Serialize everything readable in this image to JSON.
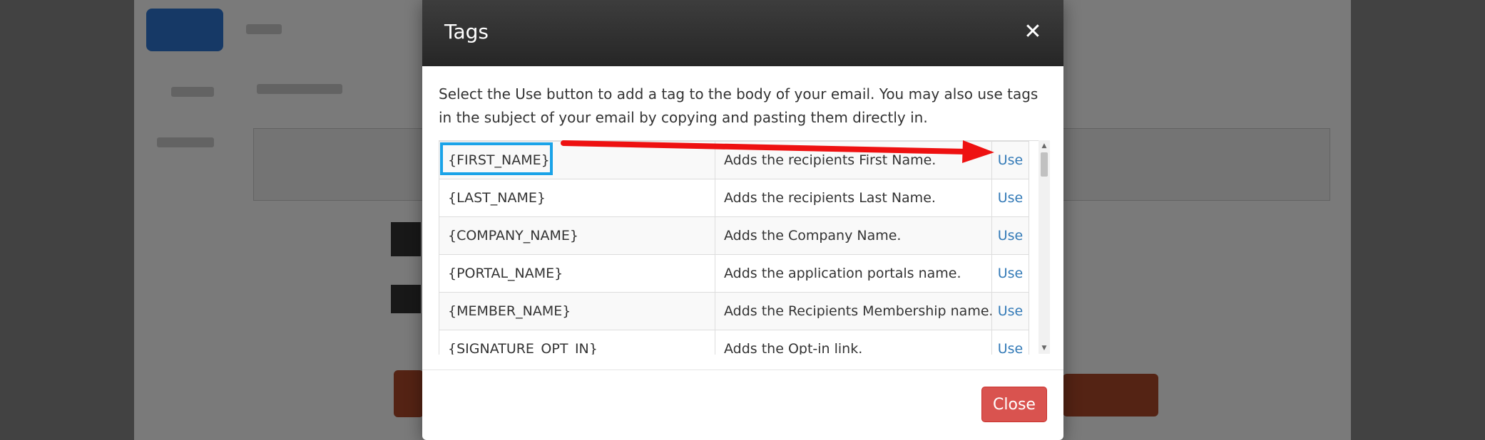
{
  "modal": {
    "title": "Tags",
    "close_icon": "close-icon",
    "description": "Select the Use button to add a tag to the body of your email. You may also use tags in the subject of your email by copying and pasting them directly in.",
    "close_button_label": "Close",
    "rows": [
      {
        "tag": "{FIRST_NAME}",
        "description": "Adds the recipients First Name.",
        "action": "Use"
      },
      {
        "tag": "{LAST_NAME}",
        "description": "Adds the recipients Last Name.",
        "action": "Use"
      },
      {
        "tag": "{COMPANY_NAME}",
        "description": "Adds the Company Name.",
        "action": "Use"
      },
      {
        "tag": "{PORTAL_NAME}",
        "description": "Adds the application portals name.",
        "action": "Use"
      },
      {
        "tag": "{MEMBER_NAME}",
        "description": "Adds the Recipients Membership name.",
        "action": "Use"
      },
      {
        "tag": "{SIGNATURE_OPT_IN}",
        "description": "Adds the Opt-in link.",
        "action": "Use"
      }
    ]
  },
  "colors": {
    "header_bg": "#2f2f2f",
    "link": "#337ab7",
    "close_button": "#d9534f",
    "highlight": "#1aa3e8",
    "arrow": "#ee1111"
  }
}
